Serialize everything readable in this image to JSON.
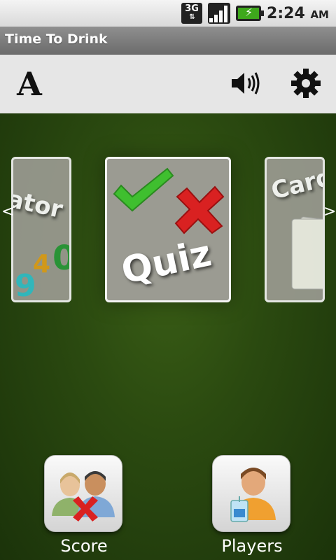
{
  "status_bar": {
    "network": "3G",
    "time": "2:24",
    "ampm": "AM"
  },
  "app": {
    "title": "Time To Drink"
  },
  "toolbar": {
    "font_icon": "A",
    "sound_icon": "speaker-icon",
    "settings_icon": "gear-icon"
  },
  "carousel": {
    "prev_arrow": "<",
    "next_arrow": ">",
    "cards": [
      {
        "label": "lator",
        "digits": [
          "4",
          "0",
          "9"
        ]
      },
      {
        "label": "Quiz"
      },
      {
        "label": "Card"
      }
    ]
  },
  "buttons": {
    "score_label": "Score",
    "players_label": "Players"
  },
  "colors": {
    "background_green": "#2b4a10",
    "check_green": "#3fbf2f",
    "cross_red": "#d92121"
  }
}
